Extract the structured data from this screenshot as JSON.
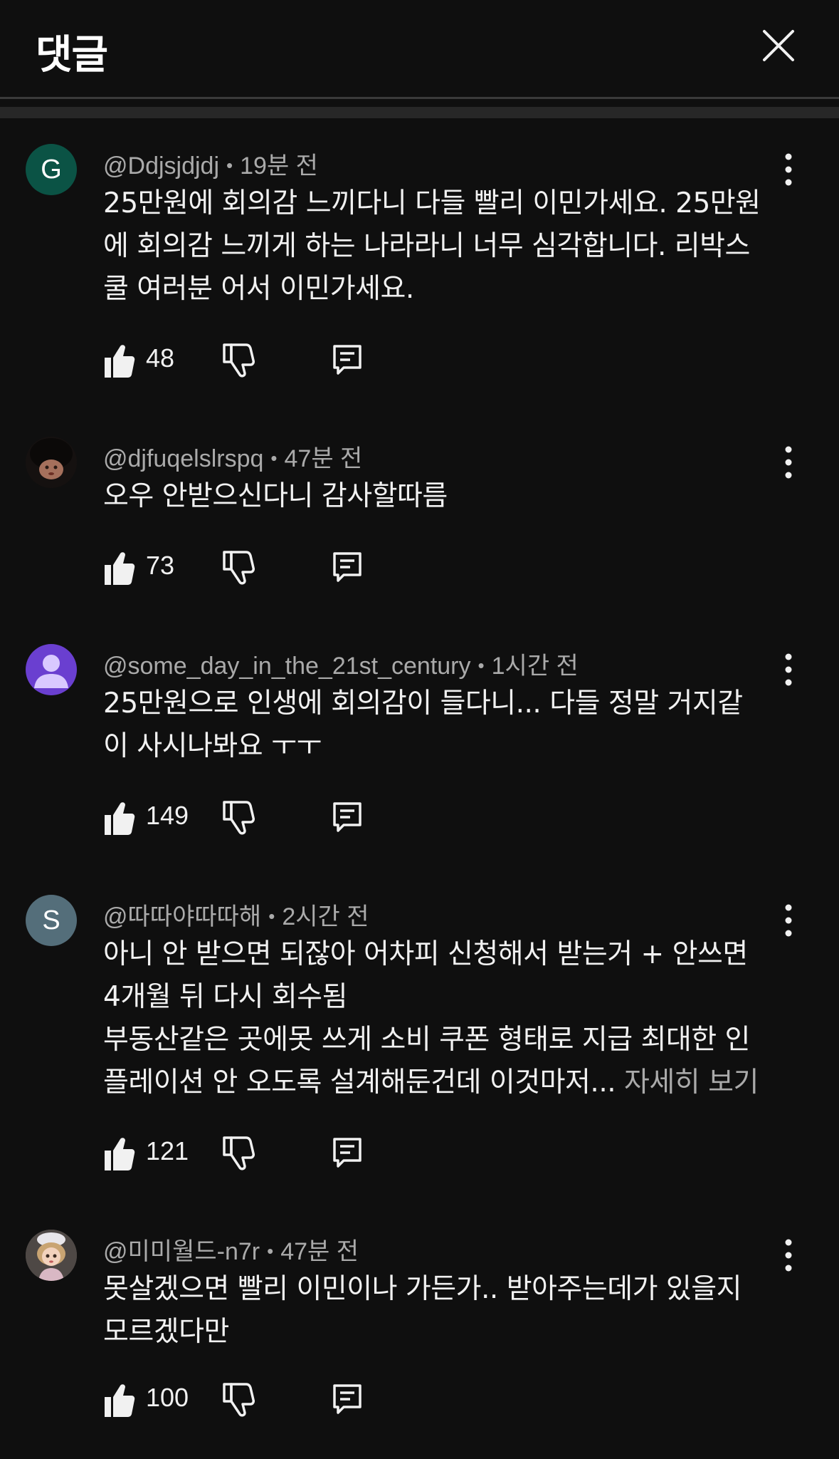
{
  "header": {
    "title": "댓글"
  },
  "comments": [
    {
      "avatar": {
        "type": "letter",
        "letter": "G",
        "color": "#0b5345"
      },
      "author": "@Ddjsjdjdj",
      "time": "19분 전",
      "text": "25만원에 회의감 느끼다니 다들 빨리 이민가세요. 25만원\n에 회의감 느끼게 하는 나라라니 너무 심각합니다. 리박스\n쿨 여러분 어서 이민가세요.",
      "likes": "48"
    },
    {
      "avatar": {
        "type": "photo",
        "icon": "doll-face-photo"
      },
      "author": "@djfuqelslrspq",
      "time": "47분 전",
      "text": "오우 안받으신다니 감사할따름",
      "likes": "73"
    },
    {
      "avatar": {
        "type": "default",
        "color": "#6a3fd0"
      },
      "author": "@some_day_in_the_21st_century",
      "time": "1시간 전",
      "text": "25만원으로 인생에 회의감이 들다니... 다들 정말 거지같\n이 사시나봐요 ㅜㅜ",
      "likes": "149"
    },
    {
      "avatar": {
        "type": "letter",
        "letter": "S",
        "color": "#546e7a"
      },
      "author": "@따따야따따해",
      "time": "2시간 전",
      "text": "아니 안 받으면 되잖아 어차피 신청해서 받는거 + 안쓰면\n4개월 뒤 다시 회수됨\n부동산같은 곳에못 쓰게 소비 쿠폰 형태로 지급 최대한 인\n플레이션 안 오도록 설계해둔건데 이것마저... ",
      "more": "자세히 보기",
      "likes": "121"
    },
    {
      "avatar": {
        "type": "photo",
        "icon": "doll-photo"
      },
      "author": "@미미월드-n7r",
      "time": "47분 전",
      "text": "못살겠으면 빨리 이민이나 가든가.. 받아주는데가 있을지\n모르겠다만",
      "likes": "100"
    }
  ]
}
